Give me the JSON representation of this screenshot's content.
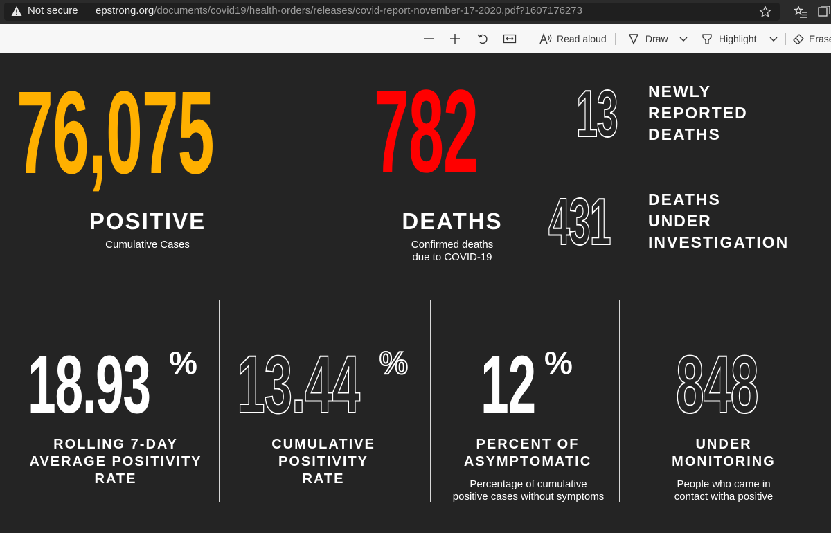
{
  "browser": {
    "security_label": "Not secure",
    "url_domain": "epstrong.org",
    "url_path": "/documents/covid19/health-orders/releases/covid-report-november-17-2020.pdf?1607176273"
  },
  "pdf_toolbar": {
    "read_aloud_label": "Read aloud",
    "draw_label": "Draw",
    "highlight_label": "Highlight",
    "erase_label": "Erase"
  },
  "report": {
    "positive": {
      "value": "76,075",
      "label": "POSITIVE",
      "sub": "Cumulative Cases",
      "color": "#ffb000"
    },
    "deaths": {
      "value": "782",
      "label": "DEATHS",
      "sub_line1": "Confirmed deaths",
      "sub_line2": "due to COVID-19",
      "color": "#ff0000"
    },
    "new_deaths": {
      "value": "13",
      "label": "NEWLY\nREPORTED\nDEATHS"
    },
    "deaths_investigation": {
      "value": "431",
      "label": "DEATHS\nUNDER\nINVESTIGATION"
    },
    "rolling_rate": {
      "value": "18.93",
      "pct": "%",
      "label_line1": "ROLLING 7-DAY",
      "label_line2": "AVERAGE POSITIVITY",
      "label_line3": "RATE"
    },
    "cumulative_rate": {
      "value": "13.44",
      "pct": "%",
      "label_line1": "CUMULATIVE",
      "label_line2": "POSITIVITY",
      "label_line3": "RATE"
    },
    "asymptomatic": {
      "value": "12",
      "pct": "%",
      "label_line1": "PERCENT OF",
      "label_line2": "ASYMPTOMATIC",
      "sub_line1": "Percentage of cumulative",
      "sub_line2": "positive cases without symptoms"
    },
    "monitoring": {
      "value": "848",
      "label_line1": "UNDER",
      "label_line2": "MONITORING",
      "sub_line1": "People who came in",
      "sub_line2": "contact witha positive"
    }
  }
}
